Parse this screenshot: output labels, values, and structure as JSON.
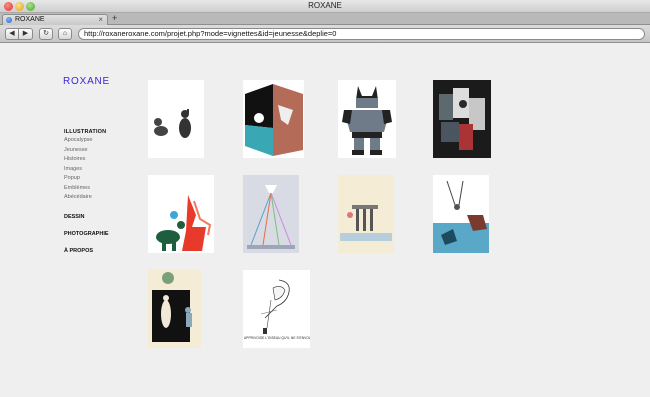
{
  "window": {
    "title": "ROXANE"
  },
  "tab": {
    "label": "ROXANE",
    "close": "×",
    "new": "+"
  },
  "toolbar": {
    "back": "◀",
    "forward": "▶",
    "reload": "↻",
    "home": "⌂",
    "url": "http://roxaneroxane.com/projet.php?mode=vignettes&id=jeunesse&deplie=0"
  },
  "page": {
    "logo": "ROXANE",
    "nav": {
      "illustration": {
        "label": "ILLUSTRATION",
        "items": [
          "Apocalypse",
          "Jeunesse",
          "Histoires",
          "Images",
          "Popup",
          "Emblèmes",
          "Abécédaire"
        ]
      },
      "dessin": "DESSIN",
      "photographie": "PHOTOGRAPHIE",
      "apropos": "À PROPOS"
    },
    "thumbnails": [
      {
        "subject": "two black dogs"
      },
      {
        "subject": "cube with rust, teal and black faces"
      },
      {
        "subject": "batman figure"
      },
      {
        "subject": "dark collage with figures"
      },
      {
        "subject": "dinosaur in red flames"
      },
      {
        "subject": "lantern with colored rays"
      },
      {
        "subject": "cream page with columns"
      },
      {
        "subject": "acrobats and blue animal"
      },
      {
        "subject": "woman in black panel"
      },
      {
        "subject": "bird sketch",
        "caption": "APPRIVOISE L'OISEAU QU'IL NE S'ENVOLE"
      }
    ]
  },
  "colors": {
    "accent": "#3a28d8",
    "background": "#efefef"
  }
}
